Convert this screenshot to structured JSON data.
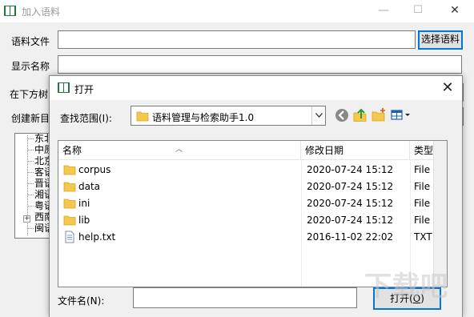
{
  "background_window": {
    "title": "加入语料",
    "minimize": "—",
    "maximize": "☐",
    "close": "✕",
    "corpus_file_label": "语料文件",
    "select_button": "选择语料",
    "display_name_label": "显示名称",
    "tree_location_label": "在下方树",
    "create_new_label": "创建新目",
    "tree_items": [
      "东北",
      "中原",
      "北京",
      "客语",
      "晋语",
      "湘语",
      "粤语",
      "西南",
      "闽语"
    ]
  },
  "dialog": {
    "title": "打开",
    "close": "✕",
    "look_in_label": "查找范围(I):",
    "look_in_value": "语料管理与检索助手1.0",
    "columns": {
      "name": "名称",
      "modified": "修改日期",
      "type": "类型"
    },
    "files": [
      {
        "name": "corpus",
        "modified": "2020-07-24 15:12",
        "type": "File Fol",
        "icon": "folder-icon"
      },
      {
        "name": "data",
        "modified": "2020-07-24 15:12",
        "type": "File Fol",
        "icon": "folder-icon"
      },
      {
        "name": "ini",
        "modified": "2020-07-24 15:12",
        "type": "File Fol",
        "icon": "folder-icon"
      },
      {
        "name": "lib",
        "modified": "2020-07-24 15:12",
        "type": "File Fol",
        "icon": "folder-icon"
      },
      {
        "name": "help.txt",
        "modified": "2016-11-02 22:02",
        "type": "TXT 文件",
        "icon": "text-file-icon"
      }
    ],
    "file_name_label": "文件名(N):",
    "file_name_value": "",
    "open_button_text": "打开(",
    "open_button_key": "O",
    "open_button_end": ")"
  },
  "watermark": "下载吧",
  "colors": {
    "accent": "#0078d7",
    "folder": "#f4c84c",
    "app_icon": "#1e7a3c"
  }
}
